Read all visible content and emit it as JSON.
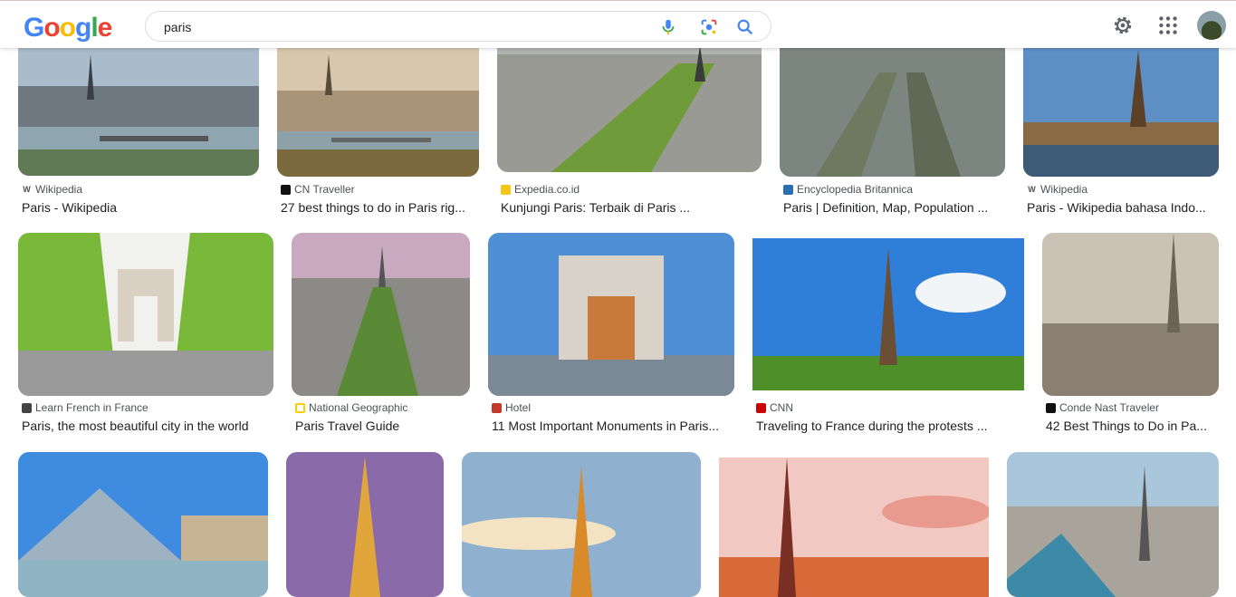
{
  "header": {
    "logo_letters": [
      "G",
      "o",
      "o",
      "g",
      "l",
      "e"
    ],
    "logo_colors": [
      "#4285F4",
      "#EA4335",
      "#FBBC05",
      "#4285F4",
      "#34A853",
      "#EA4335"
    ],
    "search_value": "paris",
    "icons": [
      "mic-icon",
      "lens-icon",
      "search-icon",
      "gear-icon",
      "apps-icon",
      "avatar"
    ]
  },
  "results": [
    {
      "source": "Wikipedia",
      "title": "Paris - Wikipedia",
      "favicon": "W",
      "favicon_color": "#ffffff"
    },
    {
      "source": "CN Traveller",
      "title": "27 best things to do in Paris rig...",
      "favicon": "",
      "favicon_color": "#111111"
    },
    {
      "source": "Expedia.co.id",
      "title": "Kunjungi Paris: Terbaik di Paris ...",
      "favicon": "",
      "favicon_color": "#f5c518"
    },
    {
      "source": "Encyclopedia Britannica",
      "title": "Paris | Definition, Map, Population ...",
      "favicon": "",
      "favicon_color": "#2a6fb0"
    },
    {
      "source": "Wikipedia",
      "title": "Paris - Wikipedia bahasa Indo...",
      "favicon": "W",
      "favicon_color": "#ffffff"
    },
    {
      "source": "Learn French in France",
      "title": "Paris, the most beautiful city in the world",
      "favicon": "",
      "favicon_color": "#444444"
    },
    {
      "source": "National Geographic",
      "title": "Paris Travel Guide",
      "favicon": "",
      "favicon_color": "#ffcc00"
    },
    {
      "source": "Hotel",
      "title": "11 Most Important Monuments in Paris...",
      "favicon": "",
      "favicon_color": "#c0392b"
    },
    {
      "source": "CNN",
      "title": "Traveling to France during the protests ...",
      "favicon": "",
      "favicon_color": "#cc0000"
    },
    {
      "source": "Conde Nast Traveler",
      "title": "42 Best Things to Do in Pa...",
      "favicon": "",
      "favicon_color": "#111111"
    }
  ]
}
